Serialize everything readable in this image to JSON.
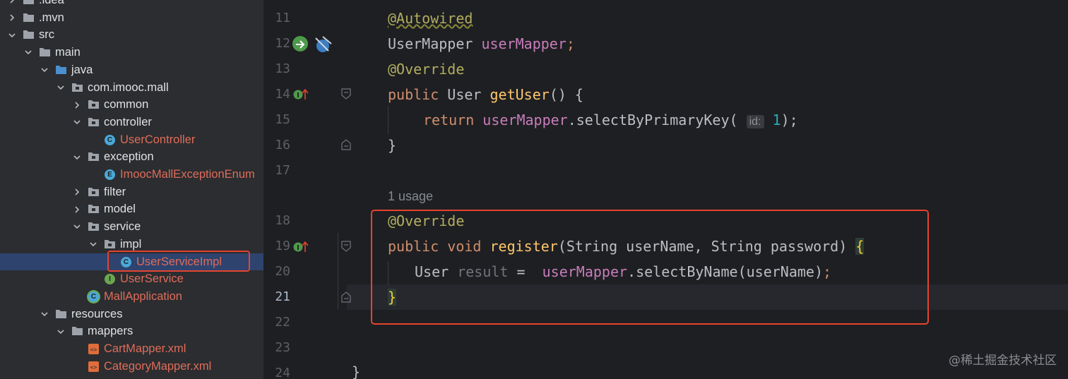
{
  "project_tree": {
    "items": [
      {
        "label": ".idea",
        "red": false,
        "icon": "folder-icon",
        "expanded": false
      },
      {
        "label": ".mvn",
        "red": false,
        "icon": "folder-icon",
        "expanded": false
      },
      {
        "label": "src",
        "red": false,
        "icon": "folder-icon",
        "expanded": true
      },
      {
        "label": "main",
        "red": false,
        "icon": "folder-icon",
        "expanded": true
      },
      {
        "label": "java",
        "red": false,
        "icon": "source-folder-icon",
        "expanded": true
      },
      {
        "label": "com.imooc.mall",
        "red": false,
        "icon": "package-icon",
        "expanded": true
      },
      {
        "label": "common",
        "red": false,
        "icon": "package-icon",
        "expanded": false
      },
      {
        "label": "controller",
        "red": false,
        "icon": "package-icon",
        "expanded": true
      },
      {
        "label": "UserController",
        "red": true,
        "icon": "class-icon",
        "badge": "C"
      },
      {
        "label": "exception",
        "red": false,
        "icon": "package-icon",
        "expanded": true
      },
      {
        "label": "ImoocMallExceptionEnum",
        "red": true,
        "icon": "enum-icon",
        "badge": "E"
      },
      {
        "label": "filter",
        "red": false,
        "icon": "package-icon",
        "expanded": false
      },
      {
        "label": "model",
        "red": false,
        "icon": "package-icon",
        "expanded": false
      },
      {
        "label": "service",
        "red": false,
        "icon": "package-icon",
        "expanded": true
      },
      {
        "label": "impl",
        "red": false,
        "icon": "package-icon",
        "expanded": true
      },
      {
        "label": "UserServiceImpl",
        "red": true,
        "icon": "class-icon",
        "badge": "C",
        "selected": true
      },
      {
        "label": "UserService",
        "red": true,
        "icon": "interface-icon",
        "badge": "I"
      },
      {
        "label": "MallApplication",
        "red": true,
        "icon": "spring-boot-class-icon",
        "badge": "C"
      },
      {
        "label": "resources",
        "red": false,
        "icon": "resources-folder-icon",
        "expanded": true
      },
      {
        "label": "mappers",
        "red": false,
        "icon": "folder-icon",
        "expanded": true
      },
      {
        "label": "CartMapper.xml",
        "red": true,
        "icon": "xml-file-icon"
      },
      {
        "label": "CategoryMapper.xml",
        "red": true,
        "icon": "xml-file-icon"
      }
    ]
  },
  "editor": {
    "line_numbers": [
      "11",
      "12",
      "13",
      "14",
      "15",
      "16",
      "17",
      "18",
      "19",
      "20",
      "21",
      "22",
      "23",
      "24"
    ],
    "current_line": "21",
    "usage_hint": "1 usage",
    "param_hint": "id:",
    "lines": {
      "l11_ann": "@Autowired",
      "l12_type": "UserMapper",
      "l12_field": "userMapper",
      "l12_semi": ";",
      "l13_ann": "@Override",
      "l14_kw": "public",
      "l14_type": "User",
      "l14_fn": "getUser",
      "l14_rest": "() {",
      "l15_kw": "return",
      "l15_field": "userMapper",
      "l15_call": ".selectByPrimaryKey(",
      "l15_num": "1",
      "l15_end": ");",
      "l16": "}",
      "l18_ann": "@Override",
      "l19_kw1": "public",
      "l19_kw2": "void",
      "l19_fn": "register",
      "l19_params": "(String userName, String password) ",
      "l19_brace": "{",
      "l20_type": "User",
      "l20_var": "result",
      "l20_eq": " =  ",
      "l20_field": "userMapper",
      "l20_call": ".selectByName(userName)",
      "l20_semi": ";",
      "l21_brace": "}",
      "l24": "}"
    }
  },
  "watermark": "@稀土掘金技术社区",
  "colors": {
    "highlight_box": "#e5432f",
    "selection": "#2e436e"
  }
}
